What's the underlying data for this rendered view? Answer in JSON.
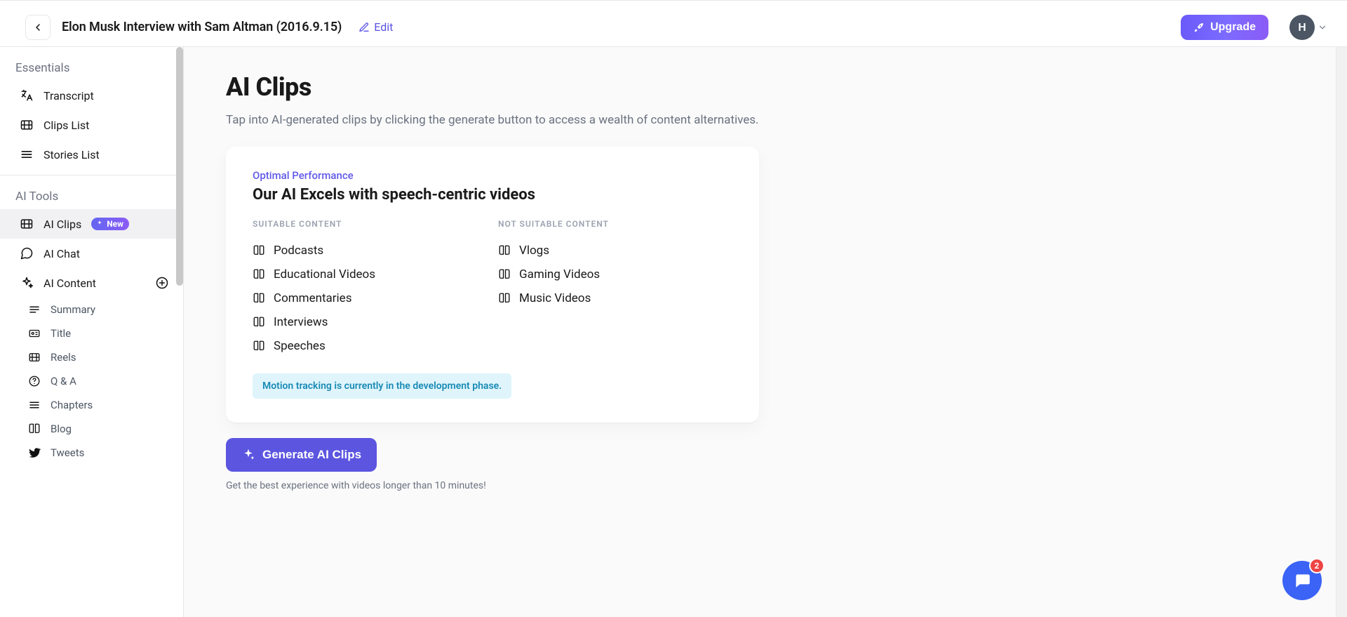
{
  "header": {
    "title": "Elon Musk Interview with Sam Altman (2016.9.15)",
    "edit_label": "Edit",
    "upgrade_label": "Upgrade",
    "avatar_initial": "H"
  },
  "sidebar": {
    "sections": {
      "essentials_label": "Essentials",
      "ai_tools_label": "AI Tools"
    },
    "essentials": [
      {
        "label": "Transcript"
      },
      {
        "label": "Clips List"
      },
      {
        "label": "Stories List"
      }
    ],
    "ai_tools": [
      {
        "label": "AI Clips",
        "badge": "New",
        "active": true
      },
      {
        "label": "AI Chat"
      },
      {
        "label": "AI Content",
        "expandable": true
      }
    ],
    "ai_content_children": [
      {
        "label": "Summary"
      },
      {
        "label": "Title"
      },
      {
        "label": "Reels"
      },
      {
        "label": "Q & A"
      },
      {
        "label": "Chapters"
      },
      {
        "label": "Blog"
      },
      {
        "label": "Tweets"
      }
    ]
  },
  "main": {
    "page_title": "AI Clips",
    "page_subtitle": "Tap into AI-generated clips by clicking the generate button to access a wealth of content alternatives.",
    "card": {
      "eyebrow": "Optimal Performance",
      "title": "Our AI Excels with speech-centric videos",
      "suitable_header": "SUITABLE CONTENT",
      "not_suitable_header": "NOT SUITABLE CONTENT",
      "suitable": [
        "Podcasts",
        "Educational Videos",
        "Commentaries",
        "Interviews",
        "Speeches"
      ],
      "not_suitable": [
        "Vlogs",
        "Gaming Videos",
        "Music Videos"
      ],
      "notice": "Motion tracking is currently in the development phase."
    },
    "generate_label": "Generate AI Clips",
    "generate_note": "Get the best experience with videos longer than 10 minutes!"
  },
  "chat": {
    "unread": "2"
  }
}
